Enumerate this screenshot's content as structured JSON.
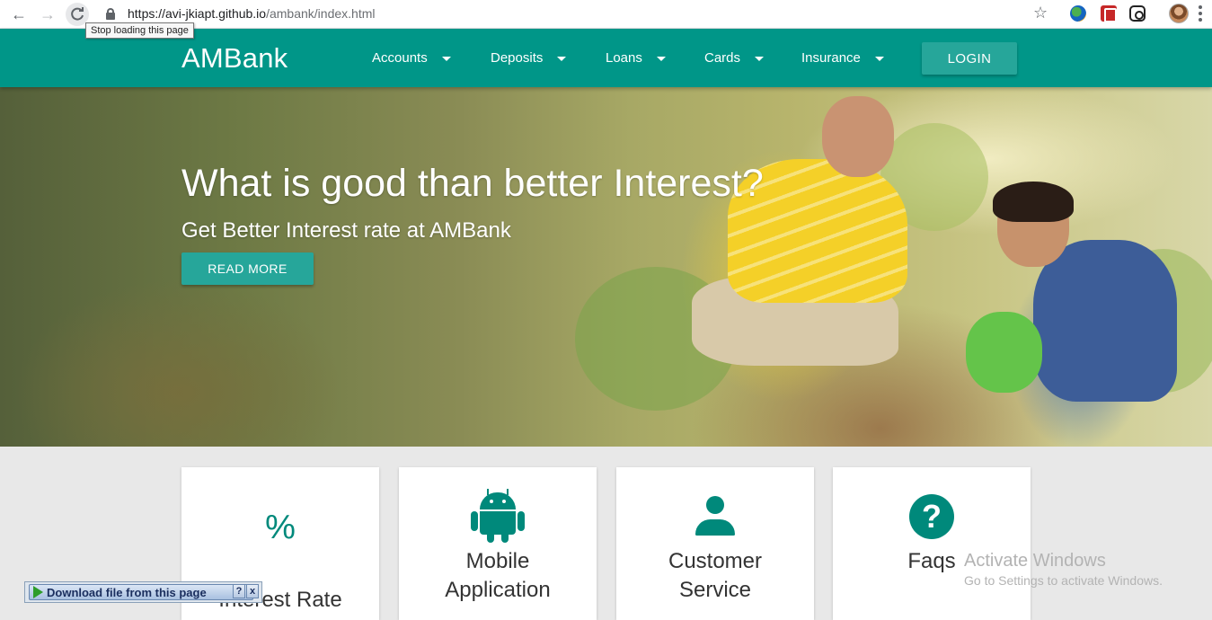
{
  "browser": {
    "url_host": "https://avi-jkiapt.github.io",
    "url_path": "/ambank/index.html",
    "tooltip": "Stop loading this page"
  },
  "navbar": {
    "brand": "AMBank",
    "menu": [
      {
        "label": "Accounts"
      },
      {
        "label": "Deposits"
      },
      {
        "label": "Loans"
      },
      {
        "label": "Cards"
      },
      {
        "label": "Insurance"
      }
    ],
    "login_label": "LOGIN"
  },
  "hero": {
    "title": "What is good than better Interest?",
    "subtitle": "Get Better Interest rate at AMBank",
    "button_label": "READ MORE"
  },
  "cards": [
    {
      "icon": "percent-icon",
      "glyph": "%",
      "label_line1": "Interest Rate",
      "label_line2": ""
    },
    {
      "icon": "android-icon",
      "label_line1": "Mobile",
      "label_line2": "Application"
    },
    {
      "icon": "person-icon",
      "label_line1": "Customer",
      "label_line2": "Service"
    },
    {
      "icon": "help-icon",
      "glyph": "?",
      "label_line1": "Faqs",
      "label_line2": ""
    }
  ],
  "overlay": {
    "activate_title": "Activate Windows",
    "activate_sub": "Go to Settings to activate Windows.",
    "download_label": "Download file from this page",
    "help_glyph": "?",
    "close_glyph": "x"
  },
  "colors": {
    "primary": "#009688",
    "accent": "#26a69a",
    "icon": "#00897b"
  }
}
